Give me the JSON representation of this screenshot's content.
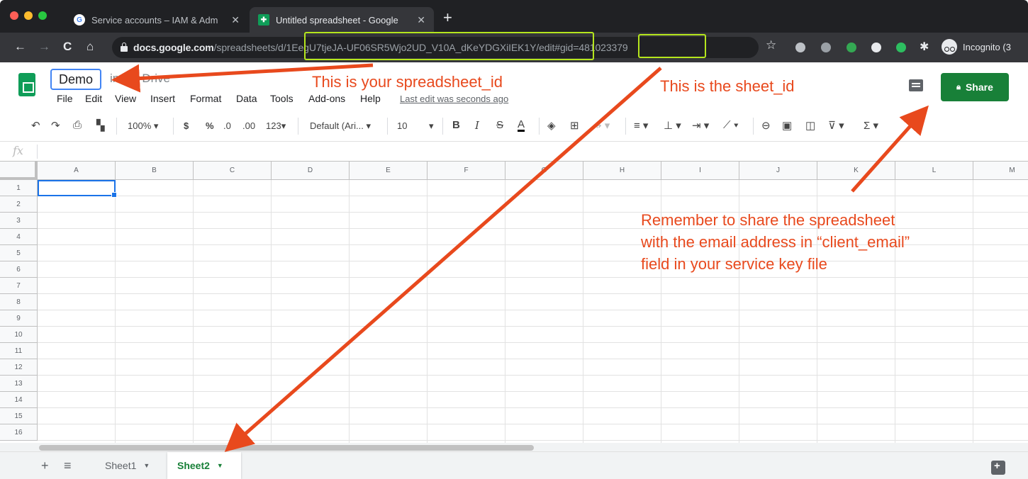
{
  "browser": {
    "tabs": [
      {
        "title": "Service accounts – IAM & Adm",
        "icon": "google-cloud-icon",
        "active": false
      },
      {
        "title": "Untitled spreadsheet - Google",
        "icon": "sheets-icon",
        "active": true
      }
    ],
    "new_tab": "+",
    "url": {
      "host": "docs.google.com",
      "path_prefix": "/spreadsheets/d",
      "spreadsheet_id": "/1EegU7tjeJA-UF06SR5Wjo2UD_V10A_dKeYDGXiIEK1Y",
      "middle": "/edit#gid",
      "gid": "=481023379"
    },
    "incognito_label": "Incognito (3",
    "accent_green": "#b5e61d"
  },
  "header": {
    "doc_title": "Demo",
    "folder_label": "in   My Drive",
    "menus": [
      "File",
      "Edit",
      "View",
      "Insert",
      "Format",
      "Data",
      "Tools",
      "Add-ons",
      "Help"
    ],
    "last_edit": "Last edit was seconds ago",
    "share_label": "Share",
    "share_color": "#188038"
  },
  "toolbar": {
    "zoom": "100%",
    "currency": "$",
    "percent": "%",
    "decimal_decrease": ".0",
    "decimal_increase": ".00",
    "more_formats": "123",
    "font_family": "Default (Ari...",
    "font_size": "10",
    "bold": "B",
    "italic": "I",
    "strike": "S",
    "text_color": "A",
    "sum": "Σ"
  },
  "formula_bar": {
    "fx": "fx"
  },
  "grid": {
    "columns": [
      "A",
      "B",
      "C",
      "D",
      "E",
      "F",
      "G",
      "H",
      "I",
      "J",
      "K",
      "L",
      "M"
    ],
    "rows": [
      "1",
      "2",
      "3",
      "4",
      "5",
      "6",
      "7",
      "8",
      "9",
      "10",
      "11",
      "12",
      "13",
      "14",
      "15",
      "16"
    ]
  },
  "sheets": {
    "tabs": [
      {
        "name": "Sheet1",
        "active": false
      },
      {
        "name": "Sheet2",
        "active": true
      }
    ]
  },
  "annotations": {
    "spreadsheet_id_note": "This is your spreadsheet_id",
    "sheet_id_note": "This is the sheet_id",
    "share_note_lines": [
      "Remember to share the spreadsheet",
      "with the email address in “client_email”",
      "field in your service key file"
    ],
    "arrow_color": "#e8491d"
  }
}
